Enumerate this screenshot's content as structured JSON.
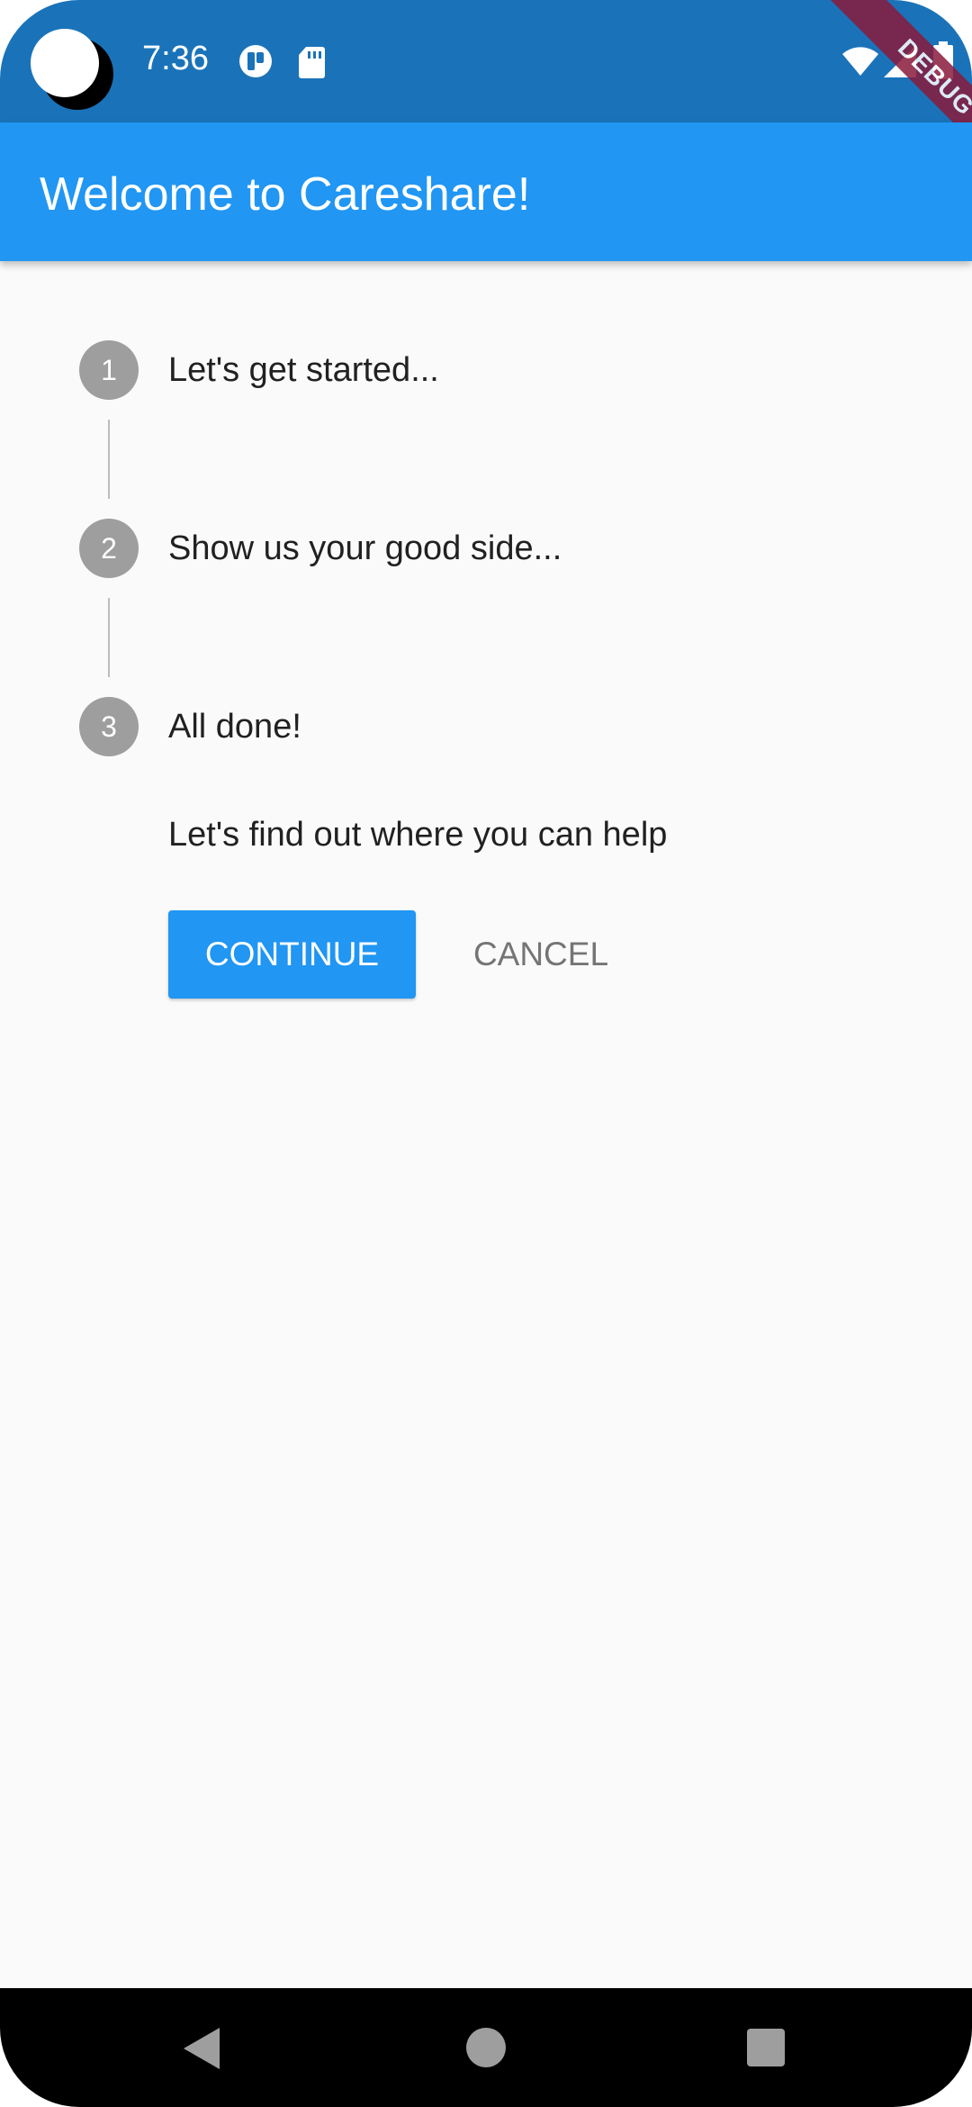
{
  "status_bar": {
    "time": "7:36",
    "icons": [
      "pip-icon",
      "sd-card-icon",
      "wifi-icon",
      "signal-icon",
      "battery-icon"
    ]
  },
  "debug_banner": "DEBUG",
  "app_bar": {
    "title": "Welcome to Careshare!",
    "color": "#2196f3"
  },
  "stepper": {
    "steps": [
      {
        "number": "1",
        "title": "Let's get started..."
      },
      {
        "number": "2",
        "title": "Show us your good side..."
      },
      {
        "number": "3",
        "title": "All done!"
      }
    ],
    "active_content": "Let's find out where you can help",
    "continue_label": "CONTINUE",
    "cancel_label": "CANCEL"
  },
  "nav_bar": {
    "icons": [
      "back-icon",
      "home-icon",
      "recents-icon"
    ]
  }
}
